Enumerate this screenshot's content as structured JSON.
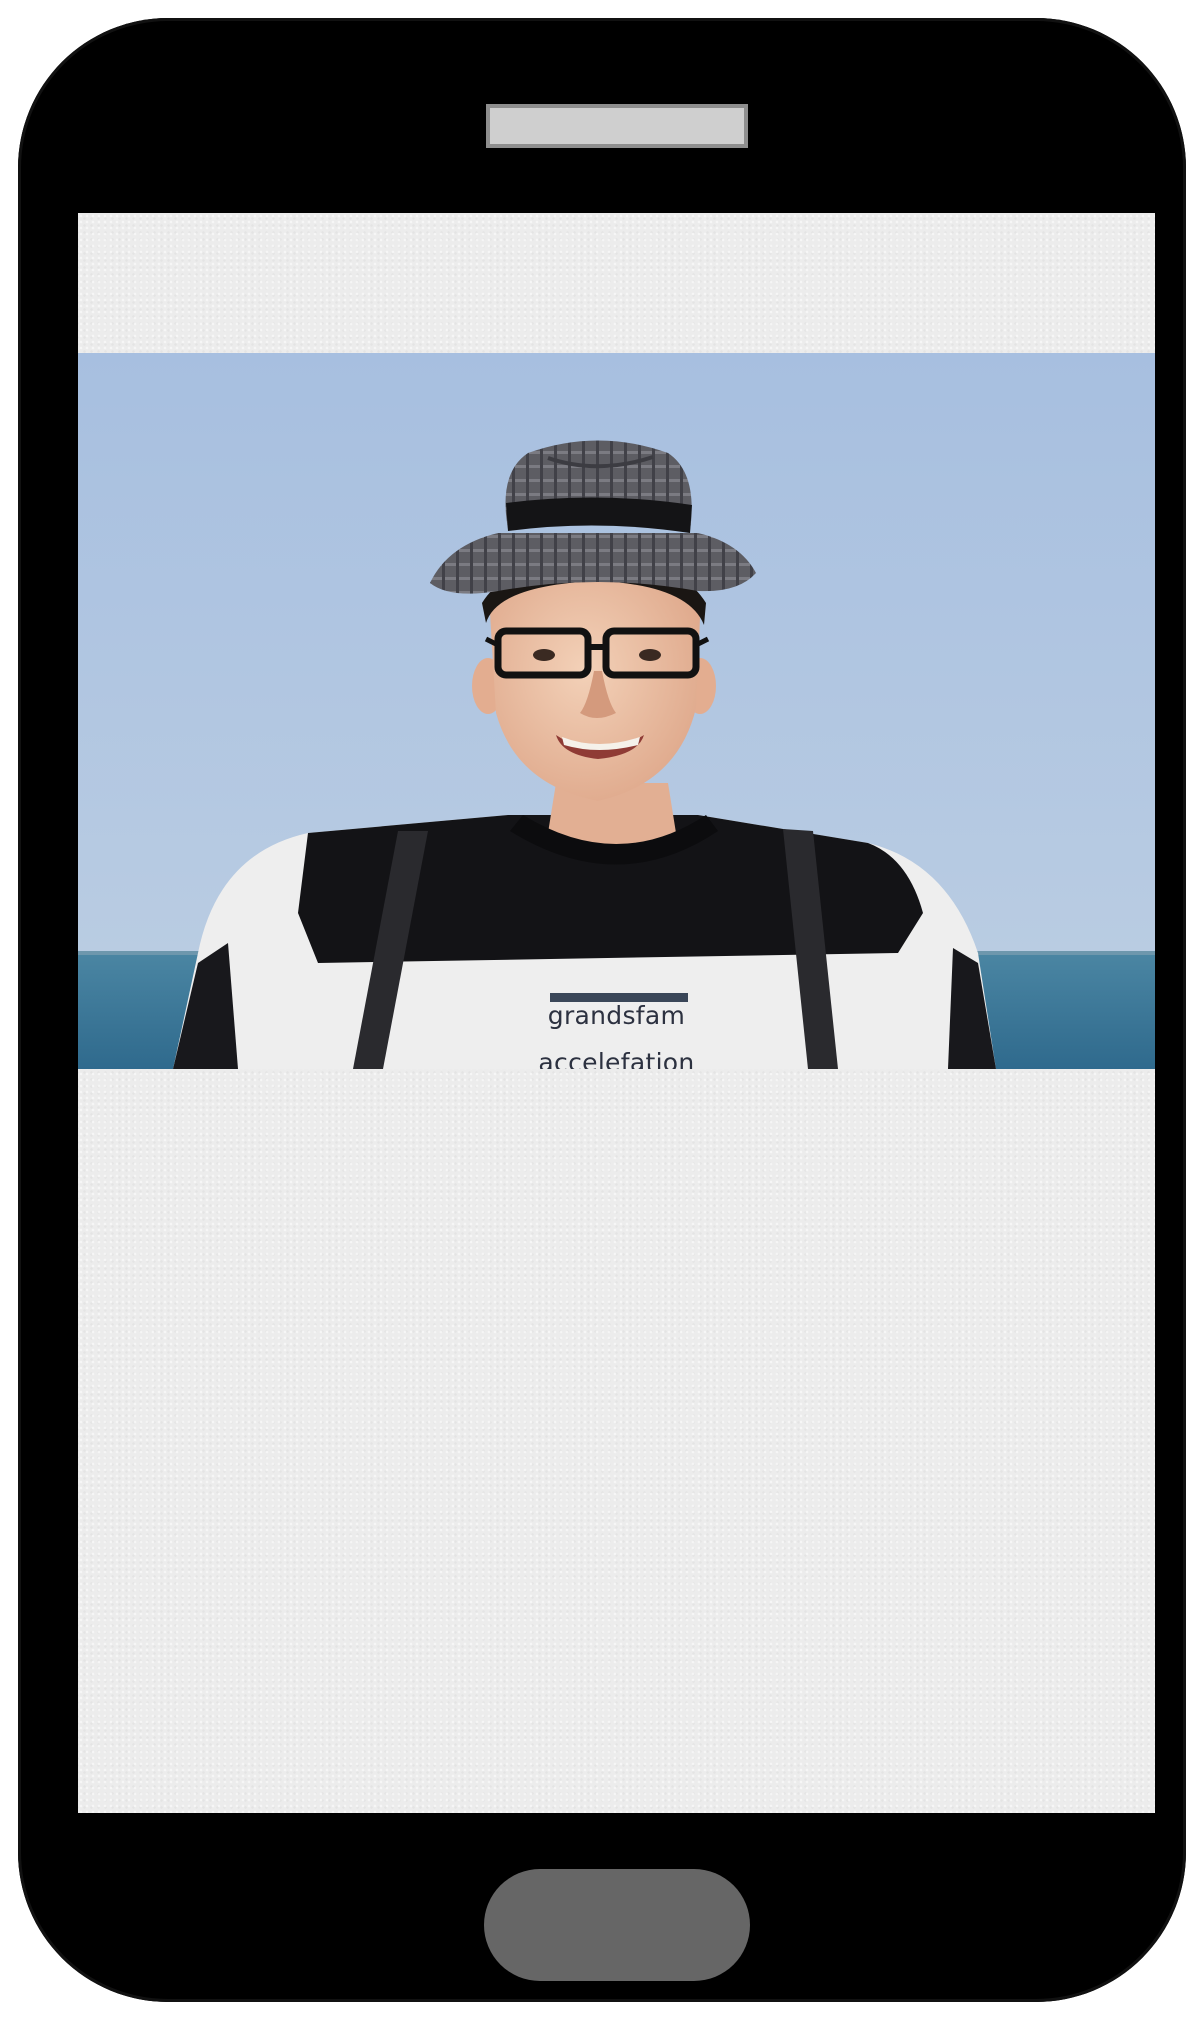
{
  "device": {
    "type": "smartphone",
    "frame_color": "#000000",
    "screen_color": "#ececec",
    "speaker_color": "#cfcfcf",
    "home_button_color": "#666666"
  },
  "screen": {
    "photo": {
      "subject": "man in fedora hat and glasses by the sea",
      "shirt_text_line1": "grandsfam",
      "shirt_text_line2": "accelefation",
      "sky_color": "#a9c0de",
      "sea_color": "#3d7797"
    }
  }
}
